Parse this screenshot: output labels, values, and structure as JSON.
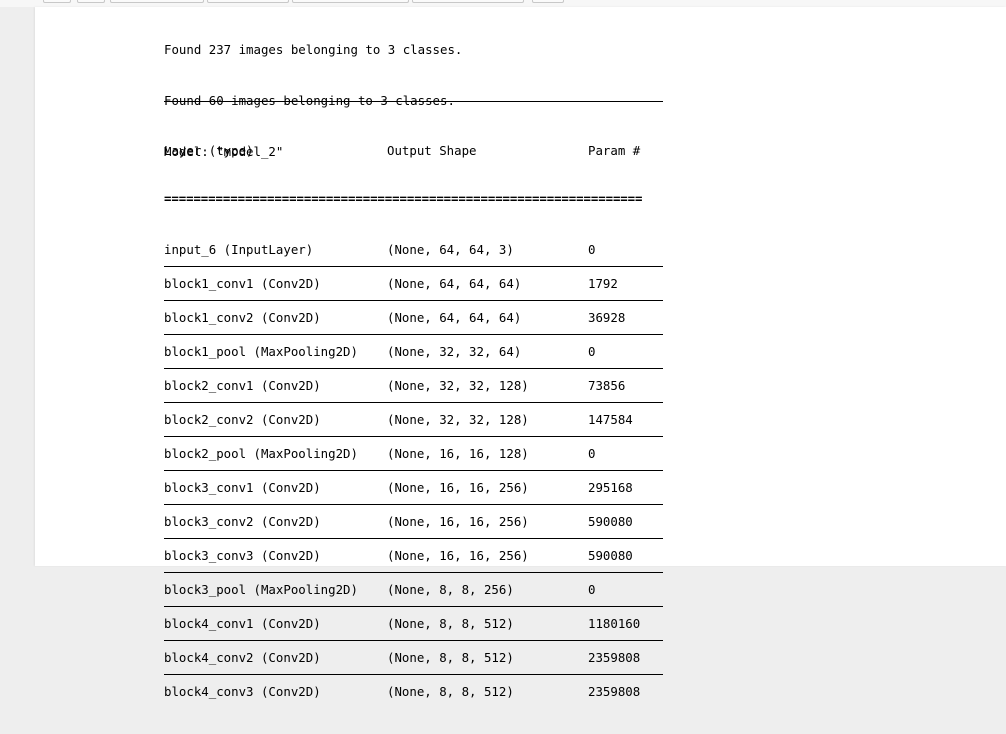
{
  "output": {
    "lines": [
      "Found 237 images belonging to 3 classes.",
      "Found 60 images belonging to 3 classes.",
      "Model: \"model_2\""
    ]
  },
  "summary": {
    "headers": {
      "layer": "Layer (type)",
      "shape": "Output Shape",
      "param": "Param #"
    },
    "double_rule": "=================================================================",
    "rows": [
      {
        "layer": "input_6 (InputLayer)",
        "shape": "(None, 64, 64, 3)",
        "param": "0"
      },
      {
        "layer": "block1_conv1 (Conv2D)",
        "shape": "(None, 64, 64, 64)",
        "param": "1792"
      },
      {
        "layer": "block1_conv2 (Conv2D)",
        "shape": "(None, 64, 64, 64)",
        "param": "36928"
      },
      {
        "layer": "block1_pool (MaxPooling2D)",
        "shape": "(None, 32, 32, 64)",
        "param": "0"
      },
      {
        "layer": "block2_conv1 (Conv2D)",
        "shape": "(None, 32, 32, 128)",
        "param": "73856"
      },
      {
        "layer": "block2_conv2 (Conv2D)",
        "shape": "(None, 32, 32, 128)",
        "param": "147584"
      },
      {
        "layer": "block2_pool (MaxPooling2D)",
        "shape": "(None, 16, 16, 128)",
        "param": "0"
      },
      {
        "layer": "block3_conv1 (Conv2D)",
        "shape": "(None, 16, 16, 256)",
        "param": "295168"
      },
      {
        "layer": "block3_conv2 (Conv2D)",
        "shape": "(None, 16, 16, 256)",
        "param": "590080"
      },
      {
        "layer": "block3_conv3 (Conv2D)",
        "shape": "(None, 16, 16, 256)",
        "param": "590080"
      },
      {
        "layer": "block3_pool (MaxPooling2D)",
        "shape": "(None, 8, 8, 256)",
        "param": "0"
      },
      {
        "layer": "block4_conv1 (Conv2D)",
        "shape": "(None, 8, 8, 512)",
        "param": "1180160"
      },
      {
        "layer": "block4_conv2 (Conv2D)",
        "shape": "(None, 8, 8, 512)",
        "param": "2359808"
      },
      {
        "layer": "block4_conv3 (Conv2D)",
        "shape": "(None, 8, 8, 512)",
        "param": "2359808"
      }
    ]
  }
}
